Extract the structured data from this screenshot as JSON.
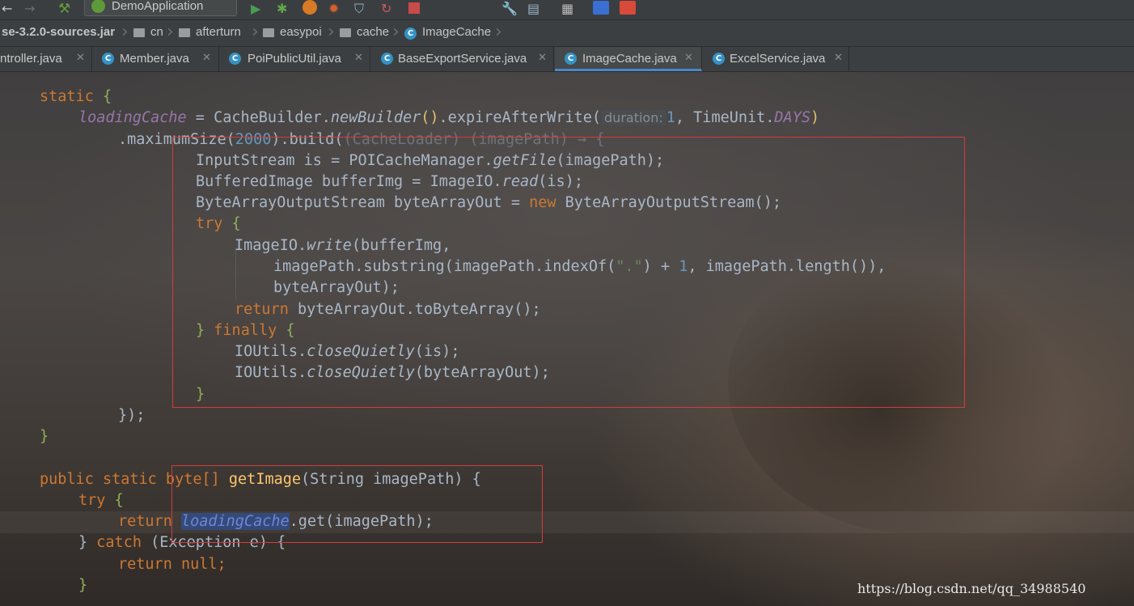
{
  "toolbar": {
    "run_config": "DemoApplication",
    "icons": [
      "back-arrow-icon",
      "forward-arrow-icon",
      "build-hammer-icon",
      "run-icon",
      "debug-icon",
      "run-coverage-icon",
      "profile-icon",
      "attach-debugger-icon",
      "reload-icon",
      "stop-icon",
      "settings-wrench-icon",
      "project-structure-icon",
      "sdk-icon",
      "translate-icon",
      "translate-alt-icon"
    ]
  },
  "breadcrumb": {
    "items": [
      "se-3.2.0-sources.jar",
      "cn",
      "afterturn",
      "easypoi",
      "cache",
      "ImageCache"
    ]
  },
  "tabs": [
    {
      "label": "ntroller.java",
      "active": false
    },
    {
      "label": "Member.java",
      "active": false
    },
    {
      "label": "PoiPublicUtil.java",
      "active": false
    },
    {
      "label": "BaseExportService.java",
      "active": false
    },
    {
      "label": "ImageCache.java",
      "active": true
    },
    {
      "label": "ExcelService.java",
      "active": false
    }
  ],
  "code": {
    "l1_static": "static",
    "l1_brace": "{",
    "l2_field": "loadingCache",
    "l2_assign": " = CacheBuilder.",
    "l2_method": "newBuilder",
    "l2_paren": "()",
    "l2_rest": ".expireAfterWrite(",
    "l2_hint": "duration:",
    "l2_num": "1",
    "l2_comma": ", TimeUnit.",
    "l2_const": "DAYS",
    "l2_close": ")",
    "l3_a": ".maximumSize(",
    "l3_num": "2000",
    "l3_b": ").build(",
    "l3_c": "(CacheLoader) (imagePath) → {",
    "l4": "InputStream is = POICacheManager.",
    "l4_m": "getFile",
    "l4_b": "(imagePath);",
    "l5": "BufferedImage bufferImg = ImageIO.",
    "l5_m": "read",
    "l5_b": "(is);",
    "l6": "ByteArrayOutputStream byteArrayOut = ",
    "l6_new": "new",
    "l6_b": " ByteArrayOutputStream();",
    "l7_try": "try",
    "l7_b": " {",
    "l8": "ImageIO.",
    "l8_m": "write",
    "l8_b": "(bufferImg,",
    "l9_a": "imagePath.substring(imagePath.indexOf(",
    "l9_str": "\".\"",
    "l9_b": ") + ",
    "l9_num": "1",
    "l9_c": ", imagePath.length()),",
    "l10": "byteArrayOut);",
    "l11_ret": "return",
    "l11_b": " byteArrayOut.toByteArray();",
    "l12_a": "} ",
    "l12_finally": "finally",
    "l12_b": " {",
    "l13": "IOUtils.",
    "l13_m": "closeQuietly",
    "l13_b": "(is);",
    "l14": "IOUtils.",
    "l14_m": "closeQuietly",
    "l14_b": "(byteArrayOut);",
    "l15": "}",
    "l16": "});",
    "l17": "}",
    "l18_kw": "public static",
    "l18_type": " byte[] ",
    "l18_m": "getImage",
    "l18_b": "(String imagePath) {",
    "l19_try": "try",
    "l19_b": " {",
    "l20_ret": "return",
    "l20_sel": "loadingCache",
    "l20_b": ".get(imagePath);",
    "l21_a": "} ",
    "l21_catch": "catch",
    "l21_b": " (Exception e) {",
    "l22_ret": "return",
    "l22_null": " null",
    "l22_b": ";",
    "l23": "}"
  },
  "watermark": "https://blog.csdn.net/qq_34988540",
  "colors": {
    "keyword": "#cc7832",
    "field": "#9876aa",
    "number": "#6897bb",
    "method": "#ffc66d",
    "string": "#6a8759",
    "annotation_box": "#d23c3c",
    "accent": "#4a88c7"
  }
}
